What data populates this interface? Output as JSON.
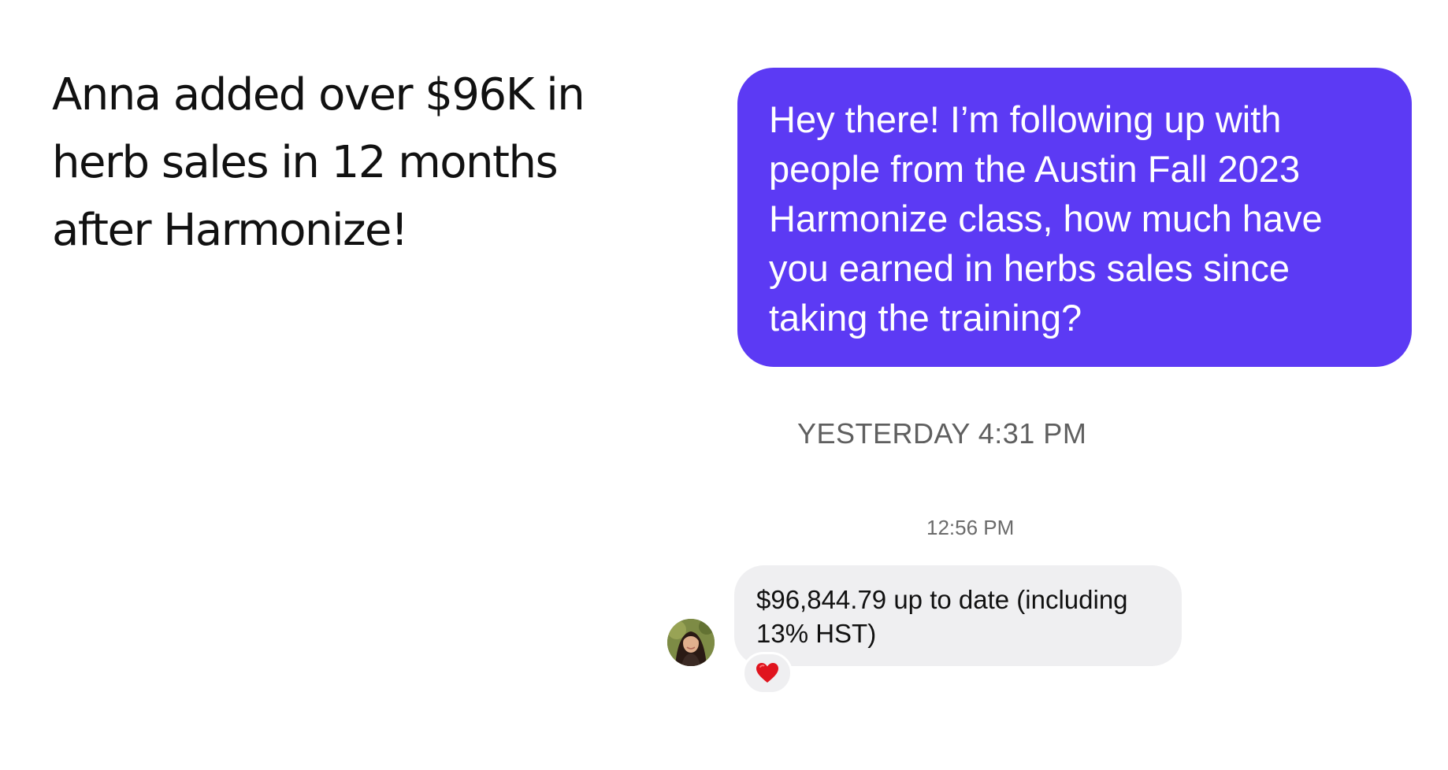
{
  "headline": {
    "lines": [
      "Anna added over $96K in",
      "herb sales in 12 months",
      "after Harmonize!"
    ]
  },
  "conversation": {
    "outgoing_message": {
      "lines": [
        "Hey there! I’m following up with",
        "people from the Austin Fall 2023",
        "Harmonize class, how much have",
        "you earned in herbs sales since",
        "taking the training?"
      ]
    },
    "day_separator": "YESTERDAY 4:31 PM",
    "reply_time": "12:56 PM",
    "incoming_message": {
      "lines": [
        "$96,844.79 up to date (including",
        "13% HST)"
      ]
    },
    "reaction": {
      "icon": "red-heart-icon",
      "color": "#e0141e"
    },
    "avatar": {
      "icon": "profile-photo"
    }
  },
  "colors": {
    "outgoing_bubble": "#5c3af4",
    "incoming_bubble": "#efeff1",
    "headline_text": "#111111"
  }
}
